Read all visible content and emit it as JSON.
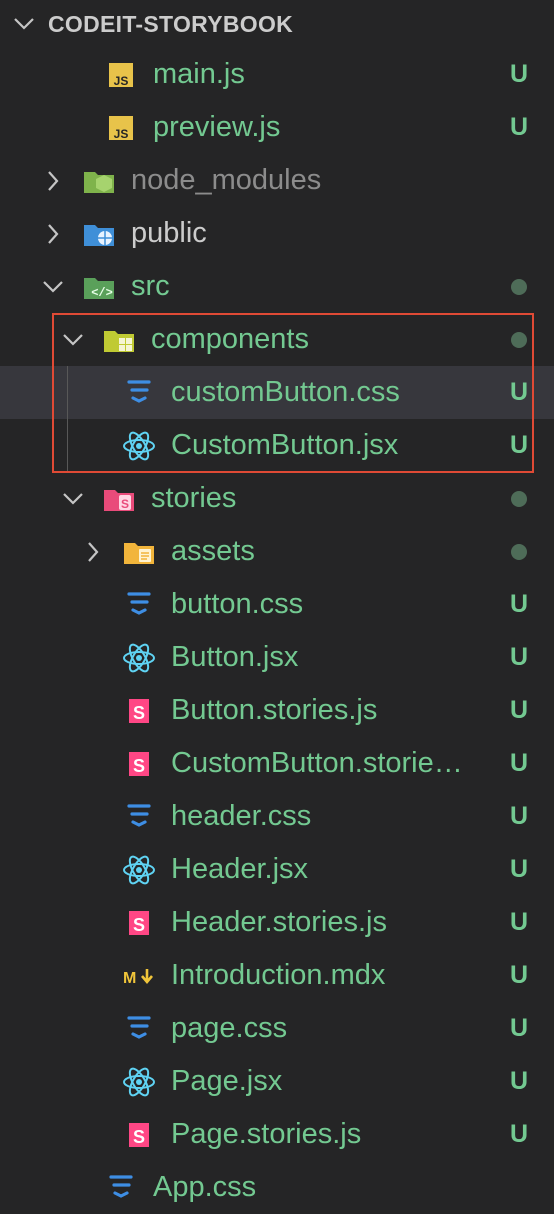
{
  "explorer": {
    "section_title": "CODEIT-STORYBOOK"
  },
  "rows": [
    {
      "name": "main.js",
      "icon": "js-icon",
      "status": "U",
      "color": "green"
    },
    {
      "name": "preview.js",
      "icon": "js-icon",
      "status": "U",
      "color": "green"
    },
    {
      "name": "node_modules",
      "icon": "node-folder-icon",
      "status": "",
      "color": "gray"
    },
    {
      "name": "public",
      "icon": "public-folder-icon",
      "status": "",
      "color": "white"
    },
    {
      "name": "src",
      "icon": "src-folder-icon",
      "status": "dot",
      "color": "green"
    },
    {
      "name": "components",
      "icon": "components-folder-icon",
      "status": "dot",
      "color": "green"
    },
    {
      "name": "customButton.css",
      "icon": "css-icon",
      "status": "U",
      "color": "green"
    },
    {
      "name": "CustomButton.jsx",
      "icon": "react-icon",
      "status": "U",
      "color": "green"
    },
    {
      "name": "stories",
      "icon": "stories-folder-icon",
      "status": "dot",
      "color": "green"
    },
    {
      "name": "assets",
      "icon": "assets-folder-icon",
      "status": "dot",
      "color": "green"
    },
    {
      "name": "button.css",
      "icon": "css-icon",
      "status": "U",
      "color": "green"
    },
    {
      "name": "Button.jsx",
      "icon": "react-icon",
      "status": "U",
      "color": "green"
    },
    {
      "name": "Button.stories.js",
      "icon": "storybook-icon",
      "status": "U",
      "color": "green"
    },
    {
      "name": "CustomButton.stories.js",
      "icon": "storybook-icon",
      "status": "U",
      "color": "green"
    },
    {
      "name": "header.css",
      "icon": "css-icon",
      "status": "U",
      "color": "green"
    },
    {
      "name": "Header.jsx",
      "icon": "react-icon",
      "status": "U",
      "color": "green"
    },
    {
      "name": "Header.stories.js",
      "icon": "storybook-icon",
      "status": "U",
      "color": "green"
    },
    {
      "name": "Introduction.mdx",
      "icon": "markdown-icon",
      "status": "U",
      "color": "green"
    },
    {
      "name": "page.css",
      "icon": "css-icon",
      "status": "U",
      "color": "green"
    },
    {
      "name": "Page.jsx",
      "icon": "react-icon",
      "status": "U",
      "color": "green"
    },
    {
      "name": "Page.stories.js",
      "icon": "storybook-icon",
      "status": "U",
      "color": "green"
    },
    {
      "name": "App.css",
      "icon": "css-icon",
      "status": "",
      "color": "green"
    }
  ],
  "colors": {
    "background": "#252526",
    "untracked": "#73c991",
    "highlight_box": "#e04a35",
    "selected_row": "#37373d"
  }
}
